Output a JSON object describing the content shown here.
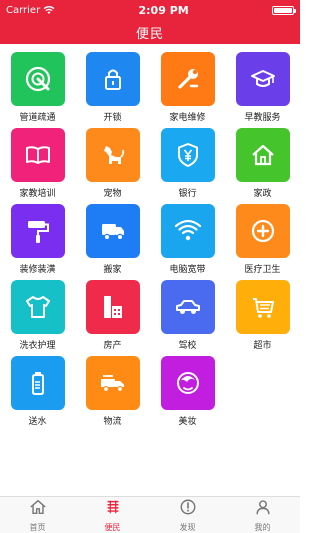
{
  "statusbar": {
    "carrier": "Carrier",
    "time": "2:09 PM"
  },
  "navbar": {
    "title": "便民"
  },
  "services": [
    {
      "label": "管道疏通",
      "icon": "pipe-icon",
      "color": "#21c45a"
    },
    {
      "label": "开锁",
      "icon": "lock-icon",
      "color": "#1e88f0"
    },
    {
      "label": "家电维修",
      "icon": "wrench-icon",
      "color": "#ff7a14"
    },
    {
      "label": "早教服务",
      "icon": "graduation-cap-icon",
      "color": "#6a3ee8"
    },
    {
      "label": "家教培训",
      "icon": "book-icon",
      "color": "#f0227a"
    },
    {
      "label": "宠物",
      "icon": "dog-icon",
      "color": "#ff8a1c"
    },
    {
      "label": "银行",
      "icon": "bank-shield-icon",
      "color": "#1aa8f0"
    },
    {
      "label": "家政",
      "icon": "house-icon",
      "color": "#45c42c"
    },
    {
      "label": "装修装潢",
      "icon": "paint-roller-icon",
      "color": "#7a2ef0"
    },
    {
      "label": "搬家",
      "icon": "truck-icon",
      "color": "#1e7cf5"
    },
    {
      "label": "电脑宽带",
      "icon": "wifi-icon",
      "color": "#1aa6ee"
    },
    {
      "label": "医疗卫生",
      "icon": "medical-plus-icon",
      "color": "#ff8a1c"
    },
    {
      "label": "洗衣护理",
      "icon": "tshirt-icon",
      "color": "#16c0c8"
    },
    {
      "label": "房产",
      "icon": "building-icon",
      "color": "#f02a4a"
    },
    {
      "label": "驾校",
      "icon": "car-icon",
      "color": "#4a6af0"
    },
    {
      "label": "超市",
      "icon": "shopping-cart-icon",
      "color": "#ffae0a"
    },
    {
      "label": "送水",
      "icon": "water-bottle-icon",
      "color": "#1a9cf0"
    },
    {
      "label": "物流",
      "icon": "delivery-truck-icon",
      "color": "#ff8a14"
    },
    {
      "label": "美妆",
      "icon": "cosmetics-face-icon",
      "color": "#c21ee0"
    }
  ],
  "tabs": [
    {
      "label": "首页",
      "icon": "home-icon",
      "active": false
    },
    {
      "label": "便民",
      "icon": "service-list-icon",
      "active": true
    },
    {
      "label": "发现",
      "icon": "discover-alert-icon",
      "active": false
    },
    {
      "label": "我的",
      "icon": "user-icon",
      "active": false
    }
  ],
  "colors": {
    "brand": "#e8243c",
    "tab_inactive": "#777777"
  }
}
